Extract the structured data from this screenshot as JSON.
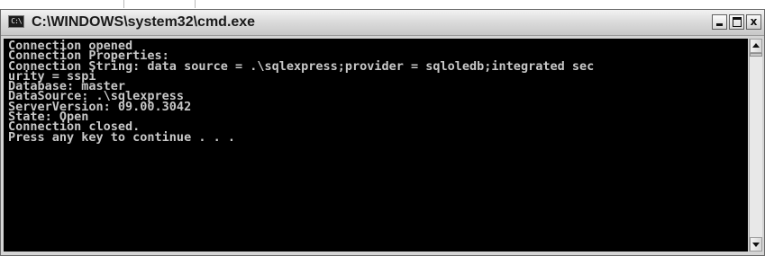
{
  "window": {
    "title": "C:\\WINDOWS\\system32\\cmd.exe",
    "icon_glyph": "C:\\",
    "icon_name": "console-icon",
    "buttons": {
      "minimize": "minimize-icon",
      "maximize": "maximize-icon",
      "close_label": "x"
    }
  },
  "console": {
    "background": "#000000",
    "text_color": "#c8c8c8",
    "lines": [
      "Connection opened",
      "Connection Properties:",
      "Connection String: data source = .\\sqlexpress;provider = sqloledb;integrated sec",
      "urity = sspi",
      "Database: master",
      "DataSource: .\\sqlexpress",
      "ServerVersion: 09.00.3042",
      "State: Open",
      "Connection closed.",
      "Press any key to continue . . ."
    ]
  },
  "scrollbar": {
    "position_fraction": 0.0
  }
}
